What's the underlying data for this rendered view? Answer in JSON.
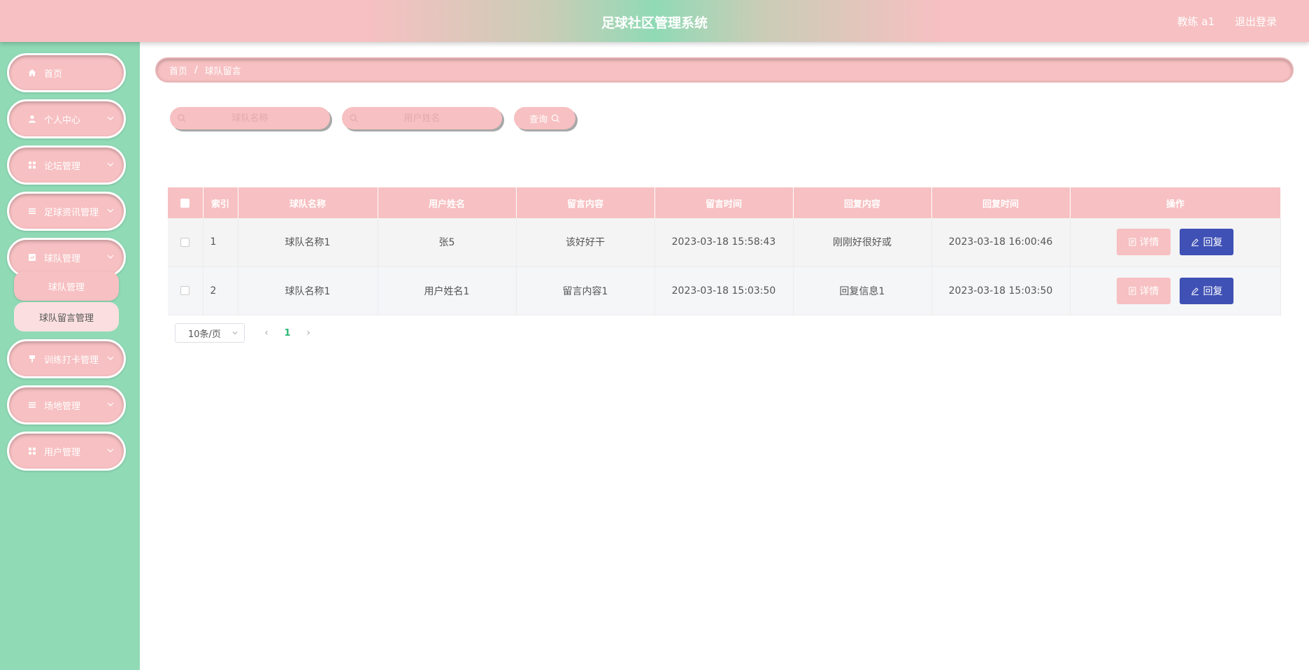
{
  "header": {
    "title": "足球社区管理系统",
    "user": "教练 a1",
    "logout": "退出登录"
  },
  "sidebar": {
    "items": [
      {
        "label": "首页",
        "icon": "home-icon",
        "expandable": false
      },
      {
        "label": "个人中心",
        "icon": "user-icon",
        "expandable": true
      },
      {
        "label": "论坛管理",
        "icon": "grid-icon",
        "expandable": true
      },
      {
        "label": "足球资讯管理",
        "icon": "list-icon",
        "expandable": true
      },
      {
        "label": "球队管理",
        "icon": "chart-icon",
        "expandable": true
      },
      {
        "label": "训练打卡管理",
        "icon": "pin-icon",
        "expandable": true
      },
      {
        "label": "场地管理",
        "icon": "list-icon",
        "expandable": true
      },
      {
        "label": "用户管理",
        "icon": "grid-icon",
        "expandable": true
      }
    ],
    "submenu": [
      {
        "label": "球队管理"
      },
      {
        "label": "球队留言管理"
      }
    ]
  },
  "breadcrumb": {
    "home": "首页",
    "separator": "/",
    "current": "球队留言"
  },
  "search": {
    "team_placeholder": "球队名称",
    "user_placeholder": "用户姓名",
    "button": "查询"
  },
  "table": {
    "headers": [
      "",
      "索引",
      "球队名称",
      "用户姓名",
      "留言内容",
      "留言时间",
      "回复内容",
      "回复时间",
      "操作"
    ],
    "rows": [
      {
        "index": "1",
        "team": "球队名称1",
        "user": "张5",
        "message": "该好好干",
        "msg_time": "2023-03-18 15:58:43",
        "reply": "刚刚好很好或",
        "reply_time": "2023-03-18 16:00:46"
      },
      {
        "index": "2",
        "team": "球队名称1",
        "user": "用户姓名1",
        "message": "留言内容1",
        "msg_time": "2023-03-18 15:03:50",
        "reply": "回复信息1",
        "reply_time": "2023-03-18 15:03:50"
      }
    ],
    "actions": {
      "detail": "详情",
      "reply": "回复"
    }
  },
  "pagination": {
    "page_size": "10条/页",
    "current_page": "1",
    "prev": "‹",
    "next": "›"
  },
  "colors": {
    "pink": "#f7c0c2",
    "mint": "#90dab6",
    "indigo": "#3f51b5",
    "active_page": "#2bb673"
  }
}
